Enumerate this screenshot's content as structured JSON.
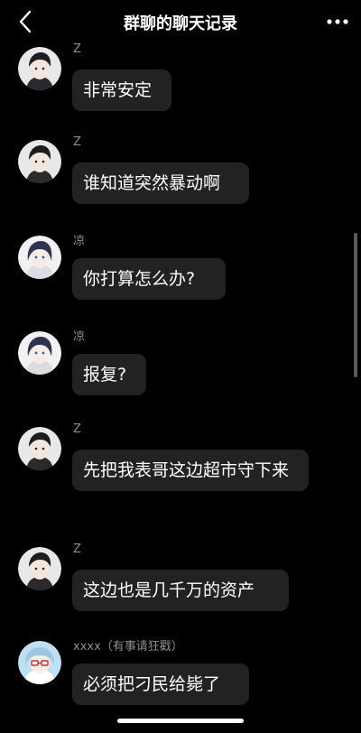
{
  "header": {
    "back_icon": "chevron-left-icon",
    "title": "群聊的聊天记录",
    "more_icon": "ellipsis-icon"
  },
  "messages": [
    {
      "sender": "Z",
      "avatar": "avatar-z",
      "text": "非常安定"
    },
    {
      "sender": "Z",
      "avatar": "avatar-z",
      "text": "谁知道突然暴动啊"
    },
    {
      "sender": "凉",
      "avatar": "avatar-liang",
      "text": "你打算怎么办?"
    },
    {
      "sender": "凉",
      "avatar": "avatar-liang",
      "text": "报复?"
    },
    {
      "sender": "Z",
      "avatar": "avatar-z",
      "text": "先把我表哥这边超市守下来"
    },
    {
      "sender": "Z",
      "avatar": "avatar-z",
      "text": "这边也是几千万的资产"
    },
    {
      "sender": "xxxx（有事请狂戳）",
      "avatar": "avatar-xxxx",
      "text": "必须把刁民给毙了"
    }
  ],
  "colors": {
    "background": "#000000",
    "bubble": "#222224",
    "sender_text": "#8e8e93",
    "text": "#ffffff"
  }
}
